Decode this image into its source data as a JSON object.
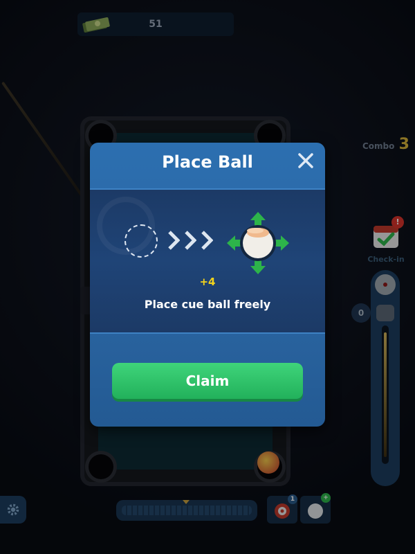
{
  "hud": {
    "money_value": "51",
    "combo_label": "Combo",
    "combo_value": "3",
    "checkin_label": "Check-in",
    "checkin_badge": "!",
    "power_offset": "0",
    "item1_badge": "1",
    "item2_badge": "+"
  },
  "modal": {
    "title": "Place Ball",
    "close_icon": "close-icon",
    "reward": "+4",
    "description": "Place cue ball freely",
    "claim_label": "Claim"
  },
  "colors": {
    "modal_blue": "#2c6fb0",
    "claim_green": "#22b15b",
    "reward_yellow": "#f2d31c",
    "arrow_green": "#2db44a"
  }
}
